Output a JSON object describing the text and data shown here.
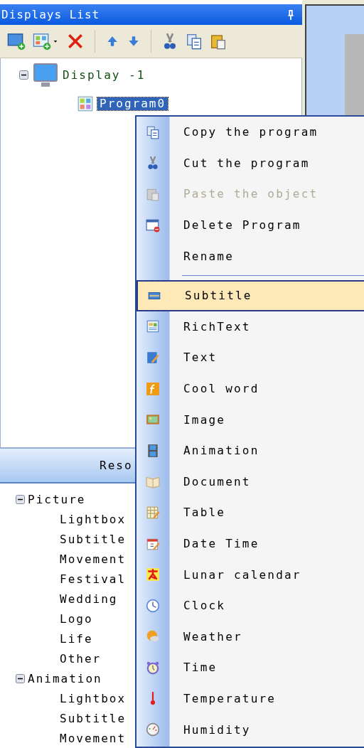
{
  "displays_panel": {
    "title": "Displays List",
    "tree": [
      {
        "label": "Display -1",
        "expanded": true,
        "children": [
          {
            "label": "Program0",
            "selected": true
          }
        ]
      }
    ]
  },
  "resources_panel": {
    "title": "Reso",
    "tree": [
      {
        "label": "Picture",
        "expanded": true,
        "children": [
          {
            "label": "Lightbox"
          },
          {
            "label": "Subtitle"
          },
          {
            "label": "Movement"
          },
          {
            "label": "Festival"
          },
          {
            "label": "Wedding"
          },
          {
            "label": "Logo"
          },
          {
            "label": "Life"
          },
          {
            "label": "Other"
          }
        ]
      },
      {
        "label": "Animation",
        "expanded": true,
        "children": [
          {
            "label": "Lightbox"
          },
          {
            "label": "Subtitle"
          },
          {
            "label": "Movement"
          }
        ]
      }
    ]
  },
  "context_menu": [
    {
      "kind": "item",
      "label": "Copy the program",
      "disabled": false,
      "selected": false
    },
    {
      "kind": "item",
      "label": "Cut the program",
      "disabled": false,
      "selected": false
    },
    {
      "kind": "item",
      "label": "Paste the object",
      "disabled": true,
      "selected": false
    },
    {
      "kind": "item",
      "label": "Delete Program",
      "disabled": false,
      "selected": false
    },
    {
      "kind": "item",
      "label": "Rename",
      "disabled": false,
      "selected": false
    },
    {
      "kind": "separator"
    },
    {
      "kind": "item",
      "label": "Subtitle",
      "disabled": false,
      "selected": true
    },
    {
      "kind": "item",
      "label": "RichText",
      "disabled": false,
      "selected": false
    },
    {
      "kind": "item",
      "label": "Text",
      "disabled": false,
      "selected": false
    },
    {
      "kind": "item",
      "label": "Cool word",
      "disabled": false,
      "selected": false
    },
    {
      "kind": "item",
      "label": "Image",
      "disabled": false,
      "selected": false
    },
    {
      "kind": "item",
      "label": "Animation",
      "disabled": false,
      "selected": false
    },
    {
      "kind": "item",
      "label": "Document",
      "disabled": false,
      "selected": false
    },
    {
      "kind": "item",
      "label": "Table",
      "disabled": false,
      "selected": false
    },
    {
      "kind": "item",
      "label": "Date Time",
      "disabled": false,
      "selected": false
    },
    {
      "kind": "item",
      "label": "Lunar calendar",
      "disabled": false,
      "selected": false
    },
    {
      "kind": "item",
      "label": "Clock",
      "disabled": false,
      "selected": false
    },
    {
      "kind": "item",
      "label": "Weather",
      "disabled": false,
      "selected": false
    },
    {
      "kind": "item",
      "label": "Time",
      "disabled": false,
      "selected": false
    },
    {
      "kind": "item",
      "label": "Temperature",
      "disabled": false,
      "selected": false
    },
    {
      "kind": "item",
      "label": "Humidity",
      "disabled": false,
      "selected": false
    }
  ]
}
